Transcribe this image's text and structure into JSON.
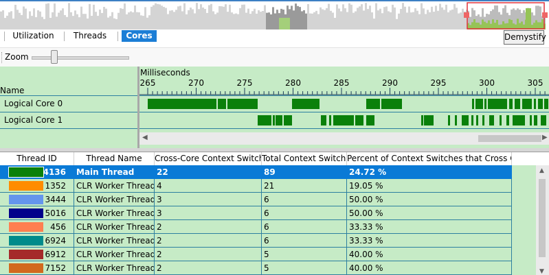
{
  "tabs": [
    {
      "label": "Utilization",
      "active": false
    },
    {
      "label": "Threads",
      "active": false
    },
    {
      "label": "Cores",
      "active": true
    }
  ],
  "demystify_label": "Demystify",
  "zoom": {
    "label": "Zoom",
    "level": 0.2
  },
  "timeline": {
    "name_header": "Name",
    "unit_label": "Milliseconds",
    "ticks": [
      "265",
      "270",
      "275",
      "280",
      "285",
      "290",
      "295",
      "300",
      "305"
    ],
    "cores": [
      {
        "name": "Logical Core 0"
      },
      {
        "name": "Logical Core 1"
      }
    ]
  },
  "colors": {
    "panel_green": "#c6ebc6",
    "activity_green": "#0a800a",
    "selection_blue": "#0a7ad6"
  },
  "table": {
    "columns": [
      "Thread ID",
      "Thread Name",
      "Cross-Core Context Switches",
      "Total Context Switches",
      "Percent of Context Switches that Cross Cores"
    ],
    "rows": [
      {
        "id": "4136",
        "name": "Main Thread",
        "cross": "22",
        "total": "89",
        "percent": "24.72 %",
        "color": "#0a800a",
        "selected": true
      },
      {
        "id": "1352",
        "name": "CLR Worker Thread",
        "cross": "4",
        "total": "21",
        "percent": "19.05 %",
        "color": "#ff8c00",
        "selected": false
      },
      {
        "id": "3444",
        "name": "CLR Worker Thread",
        "cross": "3",
        "total": "6",
        "percent": "50.00 %",
        "color": "#6495ed",
        "selected": false
      },
      {
        "id": "5016",
        "name": "CLR Worker Thread",
        "cross": "3",
        "total": "6",
        "percent": "50.00 %",
        "color": "#00008b",
        "selected": false
      },
      {
        "id": "456",
        "name": "CLR Worker Thread",
        "cross": "2",
        "total": "6",
        "percent": "33.33 %",
        "color": "#ff7f50",
        "selected": false
      },
      {
        "id": "6924",
        "name": "CLR Worker Thread",
        "cross": "2",
        "total": "6",
        "percent": "33.33 %",
        "color": "#008b8b",
        "selected": false
      },
      {
        "id": "6912",
        "name": "CLR Worker Thread",
        "cross": "2",
        "total": "5",
        "percent": "40.00 %",
        "color": "#a52a2a",
        "selected": false
      },
      {
        "id": "7152",
        "name": "CLR Worker Thread",
        "cross": "2",
        "total": "5",
        "percent": "40.00 %",
        "color": "#d2691e",
        "selected": false
      }
    ]
  }
}
